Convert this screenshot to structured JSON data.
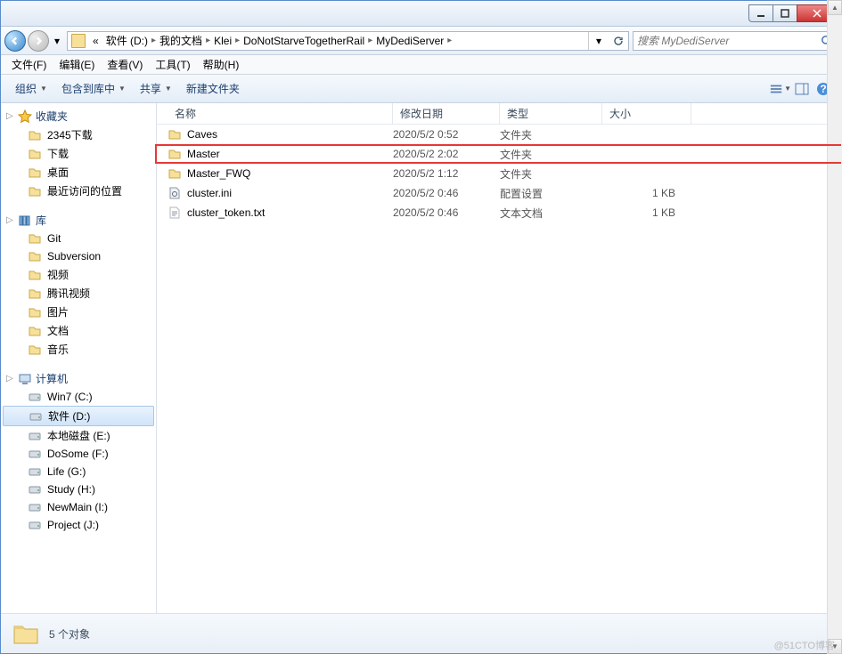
{
  "breadcrumbs": [
    "软件 (D:)",
    "我的文档",
    "Klei",
    "DoNotStarveTogetherRail",
    "MyDediServer"
  ],
  "breadcrumbs_prefix": "«",
  "search": {
    "placeholder": "搜索 MyDediServer"
  },
  "menubar": [
    "文件(F)",
    "编辑(E)",
    "查看(V)",
    "工具(T)",
    "帮助(H)"
  ],
  "toolbar": {
    "organize": "组织",
    "include": "包含到库中",
    "share": "共享",
    "newfolder": "新建文件夹"
  },
  "tree": {
    "favorites": {
      "label": "收藏夹",
      "items": [
        "2345下载",
        "下载",
        "桌面",
        "最近访问的位置"
      ]
    },
    "libraries": {
      "label": "库",
      "items": [
        "Git",
        "Subversion",
        "视频",
        "腾讯视频",
        "图片",
        "文档",
        "音乐"
      ]
    },
    "computer": {
      "label": "计算机",
      "items": [
        "Win7 (C:)",
        "软件 (D:)",
        "本地磁盘 (E:)",
        "DoSome (F:)",
        "Life (G:)",
        "Study (H:)",
        "NewMain (I:)",
        "Project (J:)"
      ],
      "selected": 1
    }
  },
  "columns": {
    "name": "名称",
    "date": "修改日期",
    "type": "类型",
    "size": "大小"
  },
  "files": [
    {
      "name": "Caves",
      "date": "2020/5/2 0:52",
      "type": "文件夹",
      "size": "",
      "kind": "folder"
    },
    {
      "name": "Master",
      "date": "2020/5/2 2:02",
      "type": "文件夹",
      "size": "",
      "kind": "folder",
      "highlighted": true
    },
    {
      "name": "Master_FWQ",
      "date": "2020/5/2 1:12",
      "type": "文件夹",
      "size": "",
      "kind": "folder"
    },
    {
      "name": "cluster.ini",
      "date": "2020/5/2 0:46",
      "type": "配置设置",
      "size": "1 KB",
      "kind": "ini"
    },
    {
      "name": "cluster_token.txt",
      "date": "2020/5/2 0:46",
      "type": "文本文档",
      "size": "1 KB",
      "kind": "txt"
    }
  ],
  "status": {
    "count": "5 个对象"
  },
  "watermark": "@51CTO博客"
}
